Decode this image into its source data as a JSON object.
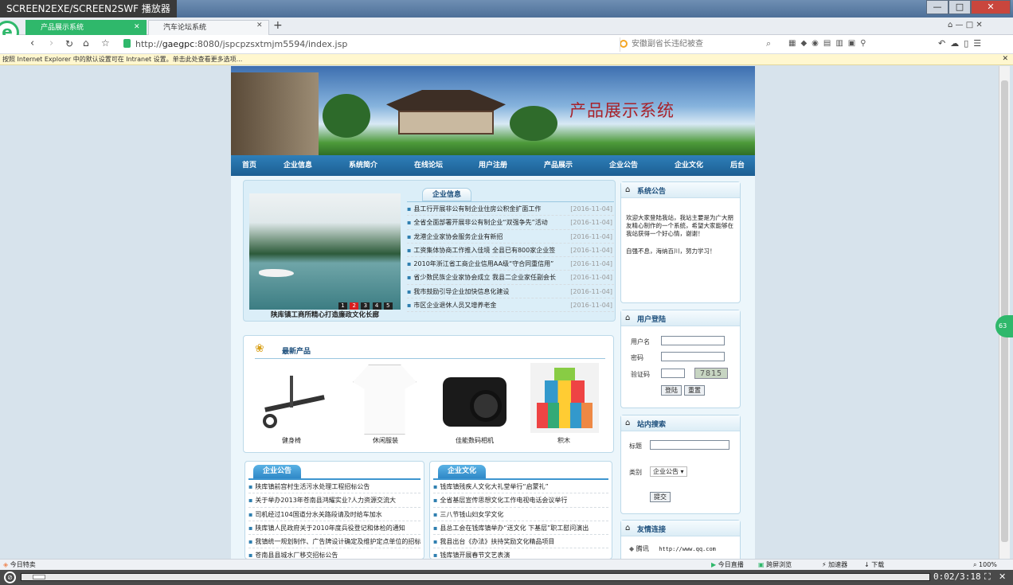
{
  "player": {
    "title": "SCREEN2EXE/SCREEN2SWF 播放器",
    "time": "0:02/3:18"
  },
  "window": {
    "minimize": "—",
    "maximize": "□",
    "close": "✕"
  },
  "tabs": [
    {
      "label": "产品展示系统"
    },
    {
      "label": "汽车论坛系统"
    }
  ],
  "address": {
    "scheme": "http://",
    "host": "gaegpc",
    "rest": ":8080/jspcpzsxtmjm5594/index.jsp",
    "search_placeholder": "安徽副省长违纪被查"
  },
  "infobar": "按照 Internet Explorer 中的默认设置可在 Intranet 设置。单击此处查看更多选项...",
  "site": {
    "title": "产品展示系统",
    "nav": [
      "首页",
      "企业信息",
      "系统简介",
      "在线论坛",
      "用户注册",
      "产品展示",
      "企业公告",
      "企业文化",
      "后台"
    ],
    "slideshow": {
      "caption": "陕库镇工商所精心打造廉政文化长廊",
      "pages": [
        "1",
        "2",
        "3",
        "4",
        "5"
      ],
      "active": 1
    },
    "enterprise_info": {
      "heading": "企业信息",
      "items": [
        {
          "text": "县工行开展非公有制企业住房公积金扩面工作",
          "date": "[2016-11-04]"
        },
        {
          "text": "全省全面部署开展非公有制企业“双强争先”活动",
          "date": "[2016-11-04]"
        },
        {
          "text": "龙港企业家协会服务企业有新招",
          "date": "[2016-11-04]"
        },
        {
          "text": "工资集体协商工作推入佳境 全县已有800家企业签",
          "date": "[2016-11-04]"
        },
        {
          "text": "2010年浙江省工商企业信用AA级“守合同重信用”",
          "date": "[2016-11-04]"
        },
        {
          "text": "省少数民族企业家协会成立 我县二企业家任副会长",
          "date": "[2016-11-04]"
        },
        {
          "text": "我市鼓励引导企业加快信息化建设",
          "date": "[2016-11-04]"
        },
        {
          "text": "市区企业退休人员又增养老金",
          "date": "[2016-11-04]"
        }
      ]
    },
    "new_products": {
      "heading": "最新产品",
      "items": [
        {
          "name": "健身椅"
        },
        {
          "name": "休闲服装"
        },
        {
          "name": "佳能数码相机"
        },
        {
          "name": "积木"
        }
      ]
    },
    "notices": {
      "heading": "企业公告",
      "items": [
        "陕库镇前宫村生活污水处理工程招标公告",
        "关于举办2013年苍南县鸿耀实业?人力资源交流大",
        "司机经过104国道分水关路段请及时给车加水",
        "陕库镇人民政府关于2010年度兵役登记和体检的通知",
        "我镇统一规划制作、广告牌设计确定及维护定点单位的招标",
        "苍南县县城水厂移交招标公告"
      ]
    },
    "culture": {
      "heading": "企业文化",
      "items": [
        "钱库镇残疾人文化大礼堂举行“启蒙礼”",
        "全省基层宣传思想文化工作电视电话会议举行",
        "三八节钱山妇女学文化",
        "县总工会在钱库镇举办“送文化 下基层”职工慰问演出",
        "我县出台《办法》扶持奖励文化精品项目",
        "钱库镇开展春节文艺表演"
      ]
    },
    "announcement": {
      "heading": "系统公告",
      "text1": "欢迎大家登陆我站，我站主要是为广大朋友精心制作的一个系统，希望大家能够在我站获得一个好心情，谢谢！",
      "text2": "自强不息，海纳百川，努力学习！"
    },
    "login": {
      "heading": "用户登陆",
      "username_label": "用户名",
      "password_label": "密码",
      "captcha_label": "验证码",
      "captcha_code": "7815",
      "login_button": "登陆",
      "reset_button": "重置"
    },
    "site_search": {
      "heading": "站内搜索",
      "title_label": "标题",
      "category_label": "类别",
      "category_value": "企业公告",
      "submit": "提交"
    },
    "links": {
      "heading": "友情连接",
      "items": [
        {
          "name": "腾讯",
          "url": "http://www.qq.com"
        }
      ]
    }
  },
  "statusbar": {
    "left": "今日特卖",
    "live": "今日直播",
    "cast": "跨屏浏览",
    "speed": "加速器",
    "download": "下载",
    "zoom": "100%"
  }
}
